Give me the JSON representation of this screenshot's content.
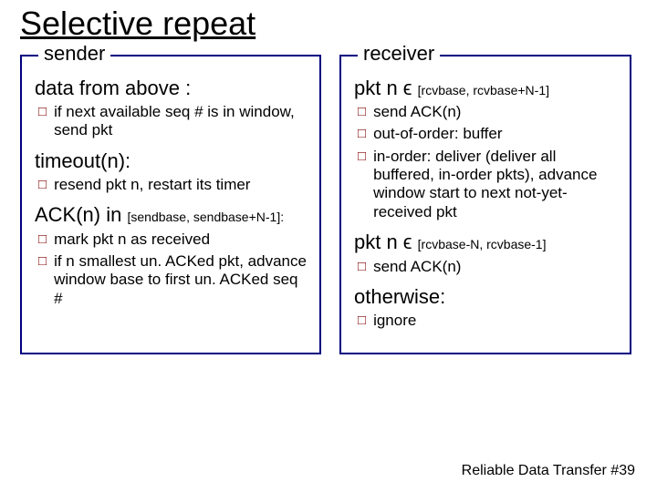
{
  "title": "Selective repeat",
  "sender": {
    "legend": "sender",
    "sections": [
      {
        "heading": "data from above :",
        "range": "",
        "items": [
          "if next available seq # is in window, send pkt"
        ]
      },
      {
        "heading": "timeout(n):",
        "range": "",
        "items": [
          "resend pkt n, restart its timer"
        ]
      },
      {
        "heading": "ACK(n) in ",
        "range": "[sendbase, sendbase+N-1]:",
        "items": [
          "mark pkt n as received",
          "if n smallest un. ACKed pkt, advance window base to first un. ACKed seq #"
        ]
      }
    ]
  },
  "receiver": {
    "legend": "receiver",
    "sections": [
      {
        "heading": "pkt n ϵ",
        "range": "[rcvbase, rcvbase+N-1]",
        "items": [
          "send ACK(n)",
          "out-of-order: buffer",
          "in-order: deliver (deliver all buffered, in-order pkts), advance window start to next not-yet-received pkt"
        ]
      },
      {
        "heading": "pkt n ϵ",
        "range": "[rcvbase-N, rcvbase-1]",
        "items": [
          "send ACK(n)"
        ]
      },
      {
        "heading": "otherwise:",
        "range": "",
        "items": [
          "ignore"
        ]
      }
    ]
  },
  "footer": "Reliable Data Transfer  #39"
}
